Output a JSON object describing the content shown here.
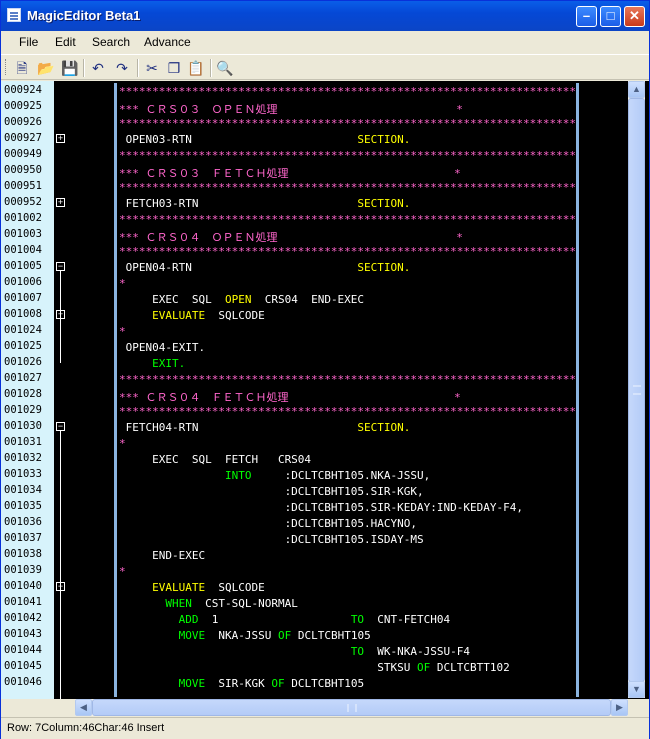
{
  "window": {
    "title": "MagicEditor Beta1"
  },
  "menu": {
    "items": [
      "File",
      "Edit",
      "Search",
      "Advance"
    ]
  },
  "toolbar": {
    "tools": [
      "new-file-icon",
      "open-folder-icon",
      "save-icon",
      "undo-icon",
      "redo-icon",
      "cut-icon",
      "copy-icon",
      "paste-icon",
      "find-icon"
    ]
  },
  "editor": {
    "lines": [
      {
        "no": "000924",
        "fold": "",
        "segments": [
          {
            "t": "**************************************************************************",
            "c": "#ff66cc"
          }
        ]
      },
      {
        "no": "000925",
        "fold": "",
        "segments": [
          {
            "t": "*** ＣＲＳ０３　ＯＰＥＮ処理",
            "c": "#ff66cc"
          },
          {
            "t": "                           *",
            "c": "#ff66cc"
          }
        ]
      },
      {
        "no": "000926",
        "fold": "",
        "segments": [
          {
            "t": "**************************************************************************",
            "c": "#ff66cc"
          }
        ]
      },
      {
        "no": "000927",
        "fold": "plus",
        "segments": [
          {
            "t": " OPEN03-RTN                         ",
            "c": "#ffffff"
          },
          {
            "t": "SECTION.",
            "c": "#ffff00"
          }
        ]
      },
      {
        "no": "000949",
        "fold": "",
        "segments": [
          {
            "t": "**************************************************************************",
            "c": "#ff66cc"
          }
        ]
      },
      {
        "no": "000950",
        "fold": "",
        "segments": [
          {
            "t": "*** ＣＲＳ０３　ＦＥＴＣＨ処理",
            "c": "#ff66cc"
          },
          {
            "t": "                         *",
            "c": "#ff66cc"
          }
        ]
      },
      {
        "no": "000951",
        "fold": "",
        "segments": [
          {
            "t": "**************************************************************************",
            "c": "#ff66cc"
          }
        ]
      },
      {
        "no": "000952",
        "fold": "plus",
        "segments": [
          {
            "t": " FETCH03-RTN                        ",
            "c": "#ffffff"
          },
          {
            "t": "SECTION.",
            "c": "#ffff00"
          }
        ]
      },
      {
        "no": "001002",
        "fold": "",
        "segments": [
          {
            "t": "**************************************************************************",
            "c": "#ff66cc"
          }
        ]
      },
      {
        "no": "001003",
        "fold": "",
        "segments": [
          {
            "t": "*** ＣＲＳ０４　ＯＰＥＮ処理",
            "c": "#ff66cc"
          },
          {
            "t": "                           *",
            "c": "#ff66cc"
          }
        ]
      },
      {
        "no": "001004",
        "fold": "",
        "segments": [
          {
            "t": "**************************************************************************",
            "c": "#ff66cc"
          }
        ]
      },
      {
        "no": "001005",
        "fold": "minus",
        "segments": [
          {
            "t": " OPEN04-RTN                         ",
            "c": "#ffffff"
          },
          {
            "t": "SECTION.",
            "c": "#ffff00"
          }
        ]
      },
      {
        "no": "001006",
        "fold": "",
        "segments": [
          {
            "t": "*",
            "c": "#ff66cc"
          }
        ]
      },
      {
        "no": "001007",
        "fold": "",
        "segments": [
          {
            "t": "     EXEC  SQL  ",
            "c": "#ffffff"
          },
          {
            "t": "OPEN",
            "c": "#ffff00"
          },
          {
            "t": "  CRS04  END-EXEC",
            "c": "#ffffff"
          }
        ]
      },
      {
        "no": "001008",
        "fold": "plus",
        "segments": [
          {
            "t": "     ",
            "c": "#ffffff"
          },
          {
            "t": "EVALUATE",
            "c": "#ffff00"
          },
          {
            "t": "  SQLCODE",
            "c": "#ffffff"
          }
        ]
      },
      {
        "no": "001024",
        "fold": "",
        "segments": [
          {
            "t": "*",
            "c": "#ff66cc"
          }
        ]
      },
      {
        "no": "001025",
        "fold": "",
        "segments": [
          {
            "t": " OPEN04-EXIT.",
            "c": "#ffffff"
          }
        ]
      },
      {
        "no": "001026",
        "fold": "end",
        "segments": [
          {
            "t": "     ",
            "c": "#ffffff"
          },
          {
            "t": "EXIT.",
            "c": "#00ff00"
          }
        ]
      },
      {
        "no": "001027",
        "fold": "",
        "segments": [
          {
            "t": "**************************************************************************",
            "c": "#ff66cc"
          }
        ]
      },
      {
        "no": "001028",
        "fold": "",
        "segments": [
          {
            "t": "*** ＣＲＳ０４　ＦＥＴＣＨ処理",
            "c": "#ff66cc"
          },
          {
            "t": "                         *",
            "c": "#ff66cc"
          }
        ]
      },
      {
        "no": "001029",
        "fold": "",
        "segments": [
          {
            "t": "**************************************************************************",
            "c": "#ff66cc"
          }
        ]
      },
      {
        "no": "001030",
        "fold": "minus",
        "segments": [
          {
            "t": " FETCH04-RTN                        ",
            "c": "#ffffff"
          },
          {
            "t": "SECTION.",
            "c": "#ffff00"
          }
        ]
      },
      {
        "no": "001031",
        "fold": "",
        "segments": [
          {
            "t": "*",
            "c": "#ff66cc"
          }
        ]
      },
      {
        "no": "001032",
        "fold": "",
        "segments": [
          {
            "t": "     EXEC  SQL  FETCH   CRS04",
            "c": "#ffffff"
          }
        ]
      },
      {
        "no": "001033",
        "fold": "",
        "segments": [
          {
            "t": "                ",
            "c": "#ffffff"
          },
          {
            "t": "INTO",
            "c": "#00ff00"
          },
          {
            "t": "     :DCLTCBHT105.NKA-JSSU,",
            "c": "#ffffff"
          }
        ]
      },
      {
        "no": "001034",
        "fold": "",
        "segments": [
          {
            "t": "                         :DCLTCBHT105.SIR-KGK,",
            "c": "#ffffff"
          }
        ]
      },
      {
        "no": "001035",
        "fold": "",
        "segments": [
          {
            "t": "                         :DCLTCBHT105.SIR-KEDAY:IND-KEDAY-F4,",
            "c": "#ffffff"
          }
        ]
      },
      {
        "no": "001036",
        "fold": "",
        "segments": [
          {
            "t": "                         :DCLTCBHT105.HACYNO,",
            "c": "#ffffff"
          }
        ]
      },
      {
        "no": "001037",
        "fold": "",
        "segments": [
          {
            "t": "                         :DCLTCBHT105.ISDAY-MS",
            "c": "#ffffff"
          }
        ]
      },
      {
        "no": "001038",
        "fold": "",
        "segments": [
          {
            "t": "     END-EXEC",
            "c": "#ffffff"
          }
        ]
      },
      {
        "no": "001039",
        "fold": "",
        "segments": [
          {
            "t": "*",
            "c": "#ff66cc"
          }
        ]
      },
      {
        "no": "001040",
        "fold": "minus",
        "segments": [
          {
            "t": "     ",
            "c": "#ffffff"
          },
          {
            "t": "EVALUATE",
            "c": "#ffff00"
          },
          {
            "t": "  SQLCODE",
            "c": "#ffffff"
          }
        ]
      },
      {
        "no": "001041",
        "fold": "",
        "segments": [
          {
            "t": "       ",
            "c": "#ffffff"
          },
          {
            "t": "WHEN",
            "c": "#00ff00"
          },
          {
            "t": "  CST-SQL-NORMAL",
            "c": "#ffffff"
          }
        ]
      },
      {
        "no": "001042",
        "fold": "",
        "segments": [
          {
            "t": "         ",
            "c": "#ffffff"
          },
          {
            "t": "ADD",
            "c": "#00ff00"
          },
          {
            "t": "  1                    ",
            "c": "#ffffff"
          },
          {
            "t": "TO",
            "c": "#00ff00"
          },
          {
            "t": "  CNT-FETCH04",
            "c": "#ffffff"
          }
        ]
      },
      {
        "no": "001043",
        "fold": "",
        "segments": [
          {
            "t": "         ",
            "c": "#ffffff"
          },
          {
            "t": "MOVE",
            "c": "#00ff00"
          },
          {
            "t": "  NKA-JSSU ",
            "c": "#ffffff"
          },
          {
            "t": "OF",
            "c": "#00ff00"
          },
          {
            "t": " DCLTCBHT105",
            "c": "#ffffff"
          }
        ]
      },
      {
        "no": "001044",
        "fold": "",
        "segments": [
          {
            "t": "                                   ",
            "c": "#ffffff"
          },
          {
            "t": "TO",
            "c": "#00ff00"
          },
          {
            "t": "  WK-NKA-JSSU-F4",
            "c": "#ffffff"
          }
        ]
      },
      {
        "no": "001045",
        "fold": "",
        "segments": [
          {
            "t": "                                       STKSU ",
            "c": "#ffffff"
          },
          {
            "t": "OF",
            "c": "#00ff00"
          },
          {
            "t": " DCLTCBTT102",
            "c": "#ffffff"
          }
        ]
      },
      {
        "no": "001046",
        "fold": "",
        "segments": [
          {
            "t": "         ",
            "c": "#ffffff"
          },
          {
            "t": "MOVE",
            "c": "#00ff00"
          },
          {
            "t": "  SIR-KGK ",
            "c": "#ffffff"
          },
          {
            "t": "OF",
            "c": "#00ff00"
          },
          {
            "t": " DCLTCBHT105",
            "c": "#ffffff"
          }
        ]
      }
    ]
  },
  "status": {
    "text": "Row: 7Column:46Char:46  Insert"
  }
}
